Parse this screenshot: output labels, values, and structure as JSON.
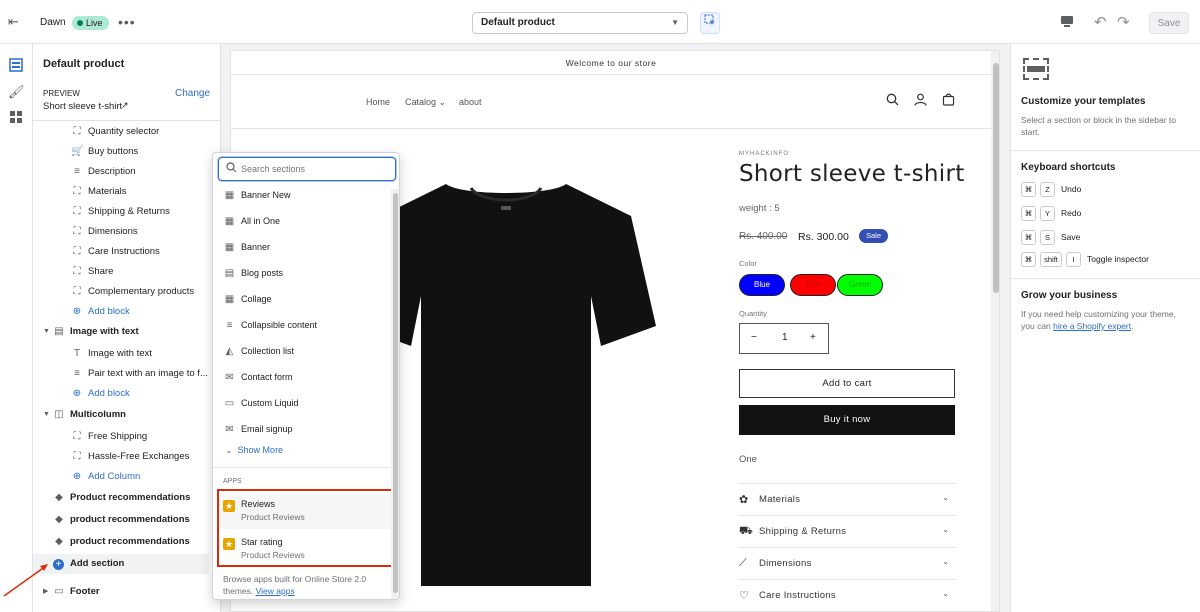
{
  "topbar": {
    "theme_name": "Dawn",
    "live_badge": "Live",
    "more_icon": "more-horizontal-icon",
    "template_select": "Default product",
    "save_label": "Save"
  },
  "sidebar": {
    "title": "Default product",
    "preview_label": "PREVIEW",
    "change_label": "Change",
    "preview_value": "Short sleeve t-shirt",
    "items": [
      {
        "type": "child",
        "icon": "block-icon",
        "label": "Quantity selector"
      },
      {
        "type": "child",
        "icon": "cart-icon",
        "label": "Buy buttons"
      },
      {
        "type": "child",
        "icon": "text-icon",
        "label": "Description"
      },
      {
        "type": "child",
        "icon": "block-icon",
        "label": "Materials"
      },
      {
        "type": "child",
        "icon": "block-icon",
        "label": "Shipping & Returns"
      },
      {
        "type": "child",
        "icon": "block-icon",
        "label": "Dimensions"
      },
      {
        "type": "child",
        "icon": "block-icon",
        "label": "Care Instructions"
      },
      {
        "type": "child",
        "icon": "block-icon",
        "label": "Share"
      },
      {
        "type": "child",
        "icon": "block-icon",
        "label": "Complementary products"
      },
      {
        "type": "add",
        "icon": "plus-circle-icon",
        "label": "Add block"
      },
      {
        "type": "section",
        "icon": "image-text-icon",
        "label": "Image with text"
      },
      {
        "type": "child",
        "icon": "heading-icon",
        "label": "Image with text"
      },
      {
        "type": "child",
        "icon": "text-icon",
        "label": "Pair text with an image to f..."
      },
      {
        "type": "add",
        "icon": "plus-circle-icon",
        "label": "Add block"
      },
      {
        "type": "section",
        "icon": "columns-icon",
        "label": "Multicolumn"
      },
      {
        "type": "child",
        "icon": "block-icon",
        "label": "Free Shipping"
      },
      {
        "type": "child",
        "icon": "block-icon",
        "label": "Hassle-Free Exchanges"
      },
      {
        "type": "add",
        "icon": "plus-circle-icon",
        "label": "Add Column"
      },
      {
        "type": "plain",
        "icon": "tag-icon",
        "label": "Product recommendations"
      },
      {
        "type": "plain",
        "icon": "tag-icon",
        "label": "product recommendations"
      },
      {
        "type": "plain",
        "icon": "tag-icon",
        "label": "product recommendations"
      },
      {
        "type": "addsec",
        "icon": "plus-circle-icon",
        "label": "Add section"
      },
      {
        "type": "section",
        "icon": "footer-icon",
        "label": "Footer"
      }
    ]
  },
  "add_section_popup": {
    "search_placeholder": "Search sections",
    "sections": [
      {
        "icon": "banner-icon",
        "label": "Banner New"
      },
      {
        "icon": "banner-icon",
        "label": "All in One"
      },
      {
        "icon": "banner-icon",
        "label": "Banner"
      },
      {
        "icon": "blog-icon",
        "label": "Blog posts"
      },
      {
        "icon": "collage-icon",
        "label": "Collage"
      },
      {
        "icon": "text-icon",
        "label": "Collapsible content"
      },
      {
        "icon": "collection-icon",
        "label": "Collection list"
      },
      {
        "icon": "contact-icon",
        "label": "Contact form"
      },
      {
        "icon": "code-icon",
        "label": "Custom Liquid"
      },
      {
        "icon": "email-icon",
        "label": "Email signup"
      }
    ],
    "show_more": "Show More",
    "apps_label": "APPS",
    "apps": [
      {
        "name": "Reviews",
        "sub": "Product Reviews"
      },
      {
        "name": "Star rating",
        "sub": "Product Reviews"
      }
    ],
    "footer_text": "Browse apps built for Online Store 2.0 themes.",
    "footer_link": "View apps"
  },
  "store": {
    "announcement": "Welcome to our store",
    "nav": [
      "Home",
      "Catalog",
      "about"
    ],
    "vendor": "MYHACKINFO",
    "product_title": "Short sleeve t-shirt",
    "weight": "weight : 5",
    "price_old": "Rs. 400.00",
    "price_new": "Rs. 300.00",
    "sale_badge": "Sale",
    "color_label": "Color",
    "colors": [
      {
        "label": "Blue",
        "bg": "#0000ff",
        "fg": "#ffffff"
      },
      {
        "label": "Red",
        "bg": "#ff0000",
        "fg": "#cc0000"
      },
      {
        "label": "Green",
        "bg": "#00ff00",
        "fg": "#00aa00"
      }
    ],
    "quantity_label": "Quantity",
    "quantity_value": "1",
    "add_to_cart": "Add to cart",
    "buy_now": "Buy it now",
    "variant_text": "One",
    "accordions": [
      {
        "icon": "leaf-icon",
        "label": "Materials"
      },
      {
        "icon": "truck-icon",
        "label": "Shipping & Returns"
      },
      {
        "icon": "ruler-icon",
        "label": "Dimensions"
      },
      {
        "icon": "heart-icon",
        "label": "Care Instructions"
      }
    ]
  },
  "right_panel": {
    "title": "Customize your templates",
    "desc": "Select a section or block in the sidebar to start.",
    "shortcuts_title": "Keyboard shortcuts",
    "shortcuts": [
      {
        "keys": [
          "⌘",
          "Z"
        ],
        "label": "Undo"
      },
      {
        "keys": [
          "⌘",
          "Y"
        ],
        "label": "Redo"
      },
      {
        "keys": [
          "⌘",
          "S"
        ],
        "label": "Save"
      },
      {
        "keys": [
          "⌘",
          "shift",
          "I"
        ],
        "label": "Toggle inspector"
      }
    ],
    "grow_title": "Grow your business",
    "grow_text": "If you need help customizing your theme, you can",
    "grow_link": "hire a Shopify expert",
    "grow_end": "."
  },
  "colors": {
    "accent": "#2c6ecb",
    "highlight": "#d82c0d",
    "sale_badge": "#334fb4"
  }
}
